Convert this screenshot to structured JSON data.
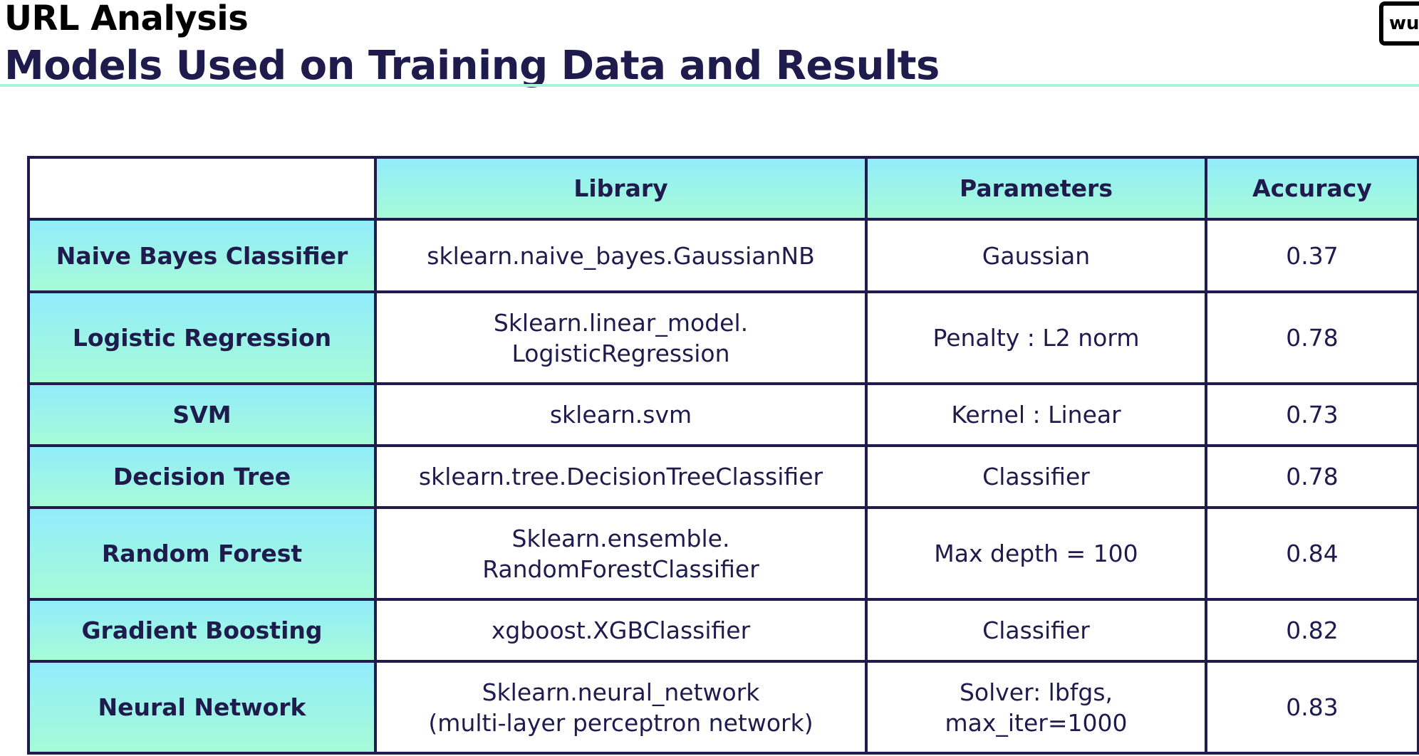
{
  "header": {
    "title": "URL Analysis",
    "subtitle": "Models Used on Training Data and Results",
    "logo_text": "wu"
  },
  "colors": {
    "navy": "#1f1b4d",
    "cyan": "#92ecfb",
    "mint": "#a6fbd7",
    "accent_rule": "#a8f5d6"
  },
  "table": {
    "columns": [
      "",
      "Library",
      "Parameters",
      "Accuracy"
    ],
    "rows": [
      {
        "model": "Naive Bayes Classifier",
        "library": "sklearn.naive_bayes.GaussianNB",
        "parameters": "Gaussian",
        "accuracy": "0.37"
      },
      {
        "model": "Logistic Regression",
        "library": "Sklearn.linear_model.\nLogisticRegression",
        "parameters": "Penalty : L2 norm",
        "accuracy": "0.78"
      },
      {
        "model": "SVM",
        "library": "sklearn.svm",
        "parameters": "Kernel : Linear",
        "accuracy": "0.73"
      },
      {
        "model": "Decision Tree",
        "library": "sklearn.tree.DecisionTreeClassifier",
        "parameters": "Classifier",
        "accuracy": "0.78"
      },
      {
        "model": "Random Forest",
        "library": "Sklearn.ensemble.\nRandomForestClassifier",
        "parameters": "Max depth = 100",
        "accuracy": "0.84"
      },
      {
        "model": "Gradient Boosting",
        "library": "xgboost.XGBClassifier",
        "parameters": "Classifier",
        "accuracy": "0.82"
      },
      {
        "model": "Neural Network",
        "library": "Sklearn.neural_network\n(multi-layer perceptron network)",
        "parameters": "Solver: lbfgs,\nmax_iter=1000",
        "accuracy": "0.83"
      }
    ]
  }
}
